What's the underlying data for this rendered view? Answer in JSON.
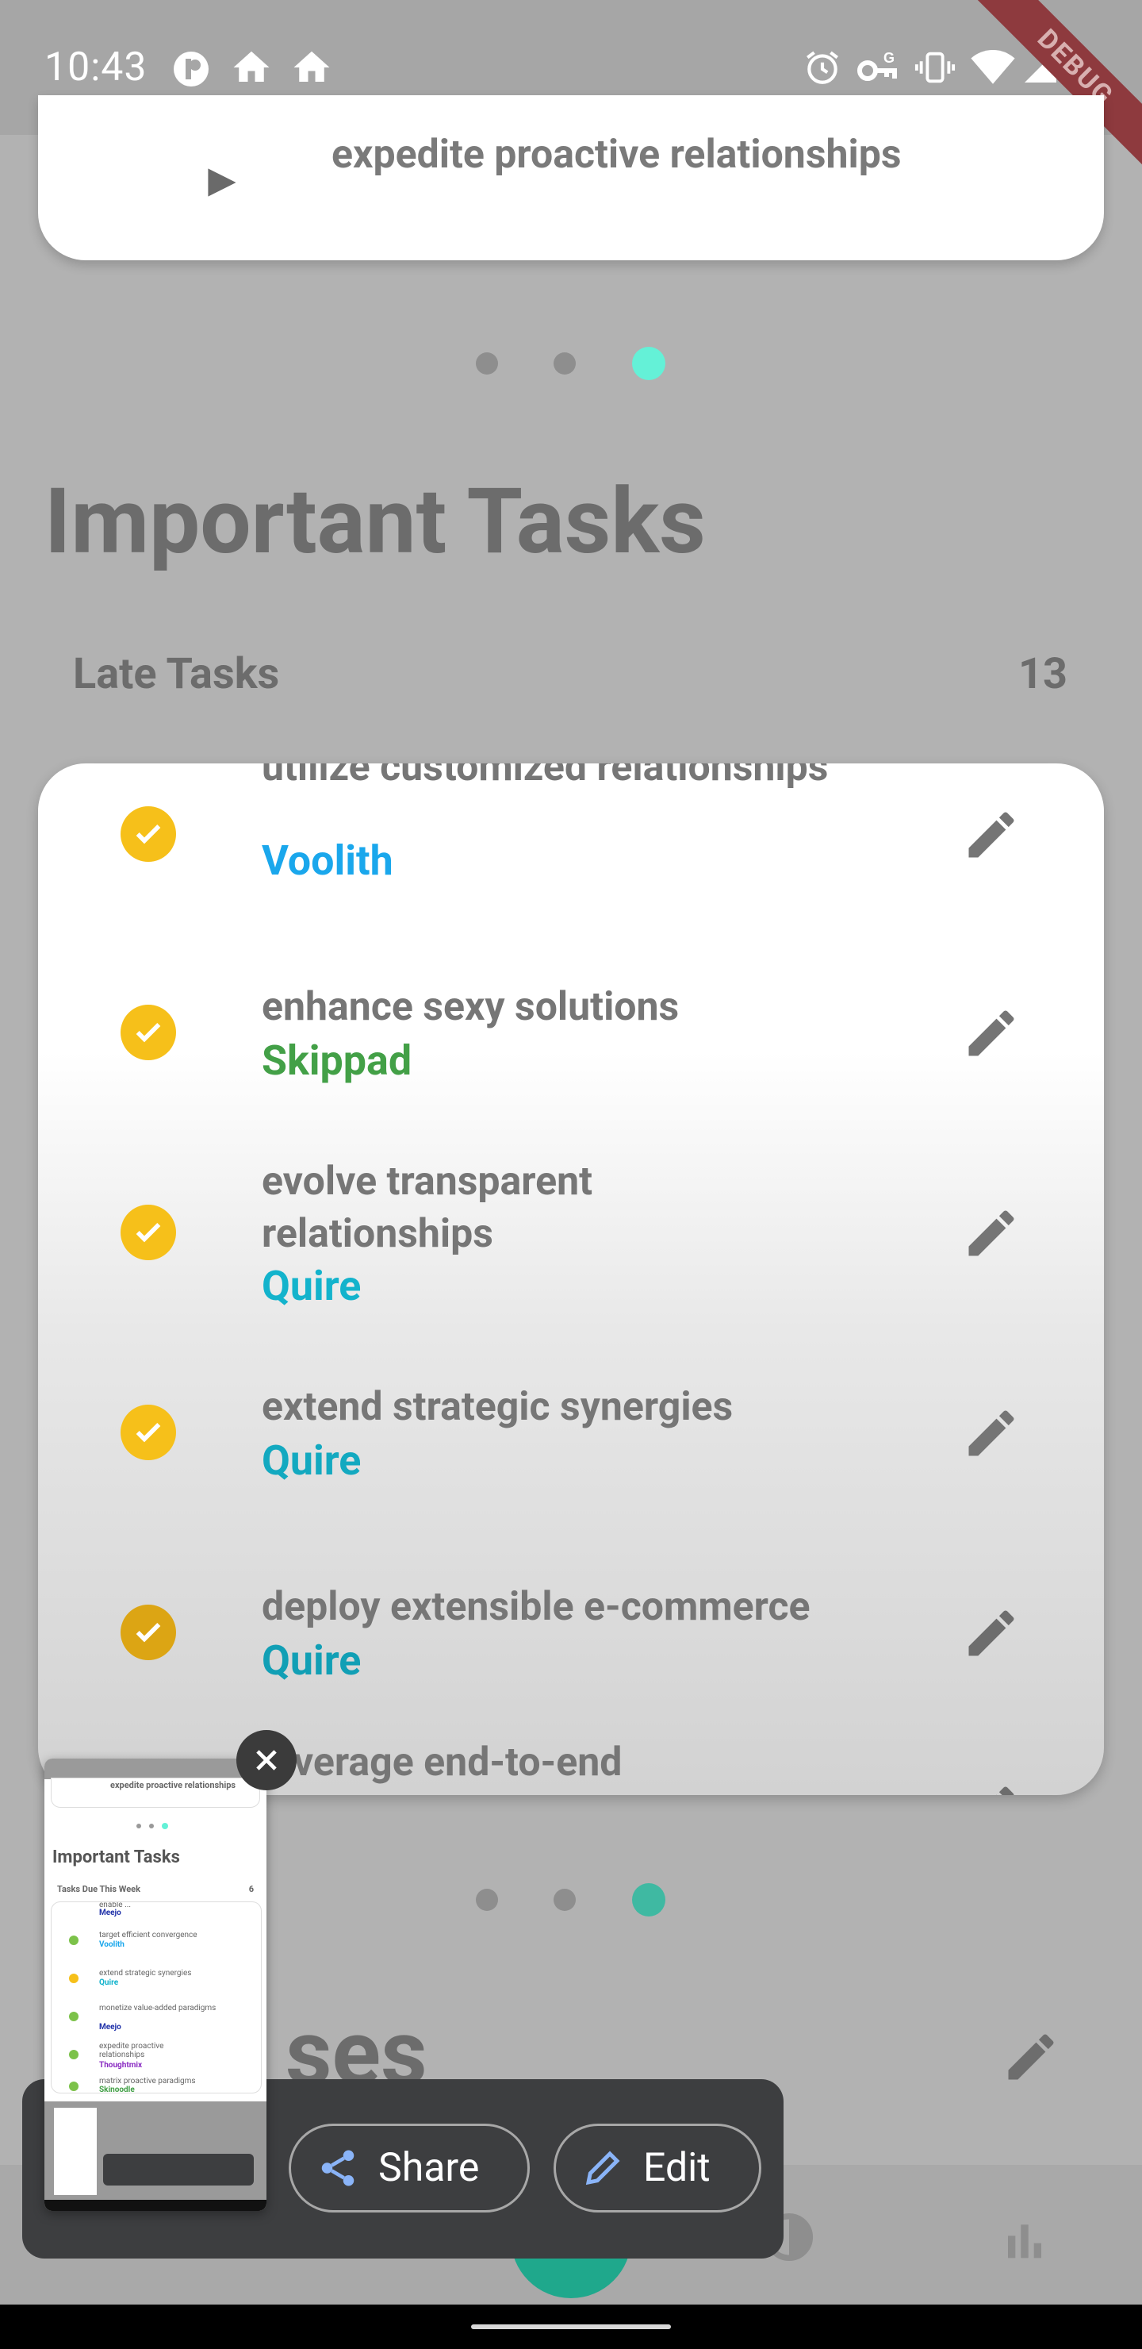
{
  "status_bar": {
    "time": "10:43"
  },
  "debug_banner": "DEBUG",
  "carousel_top": {
    "task_text": "expedite proactive relationships"
  },
  "section": {
    "title": "Important Tasks",
    "late_label": "Late Tasks",
    "late_count": "13"
  },
  "tasks": [
    {
      "title": "utilize customized relationships",
      "project": "Voolith",
      "project_color": "#1aa7ec"
    },
    {
      "title": "enhance sexy solutions",
      "project": "Skippad",
      "project_color": "#43a047"
    },
    {
      "title": "evolve transparent relationships",
      "project": "Quire",
      "project_color": "#13b3cc"
    },
    {
      "title": "extend strategic synergies",
      "project": "Quire",
      "project_color": "#13a9c0"
    },
    {
      "title": "deploy extensible e-commerce",
      "project": "Quire",
      "project_color": "#119fb5"
    },
    {
      "title": "leverage end-to-end architectures",
      "project": "",
      "project_color": "#119fb5"
    }
  ],
  "next_section": {
    "title_partial": "ses"
  },
  "share_overlay": {
    "share_label": "Share",
    "edit_label": "Edit"
  },
  "thumbnail": {
    "title": "Important Tasks",
    "subtitle": "Tasks Due This Week",
    "count": "6",
    "top_text": "expedite proactive relationships",
    "rows": [
      {
        "title": "enable ...",
        "project": "Meejo"
      },
      {
        "title": "target efficient convergence",
        "project": "Voolith"
      },
      {
        "title": "extend strategic synergies",
        "project": "Quire"
      },
      {
        "title": "monetize value-added paradigms",
        "project": "Meejo"
      },
      {
        "title": "expedite proactive relationships",
        "project": "Thoughtmix"
      },
      {
        "title": "matrix proactive paradigms",
        "project": "Skinoodle"
      }
    ]
  },
  "colors": {
    "accent": "#64f1d7",
    "check": "#f6c01a",
    "fab": "#1fa88c"
  }
}
